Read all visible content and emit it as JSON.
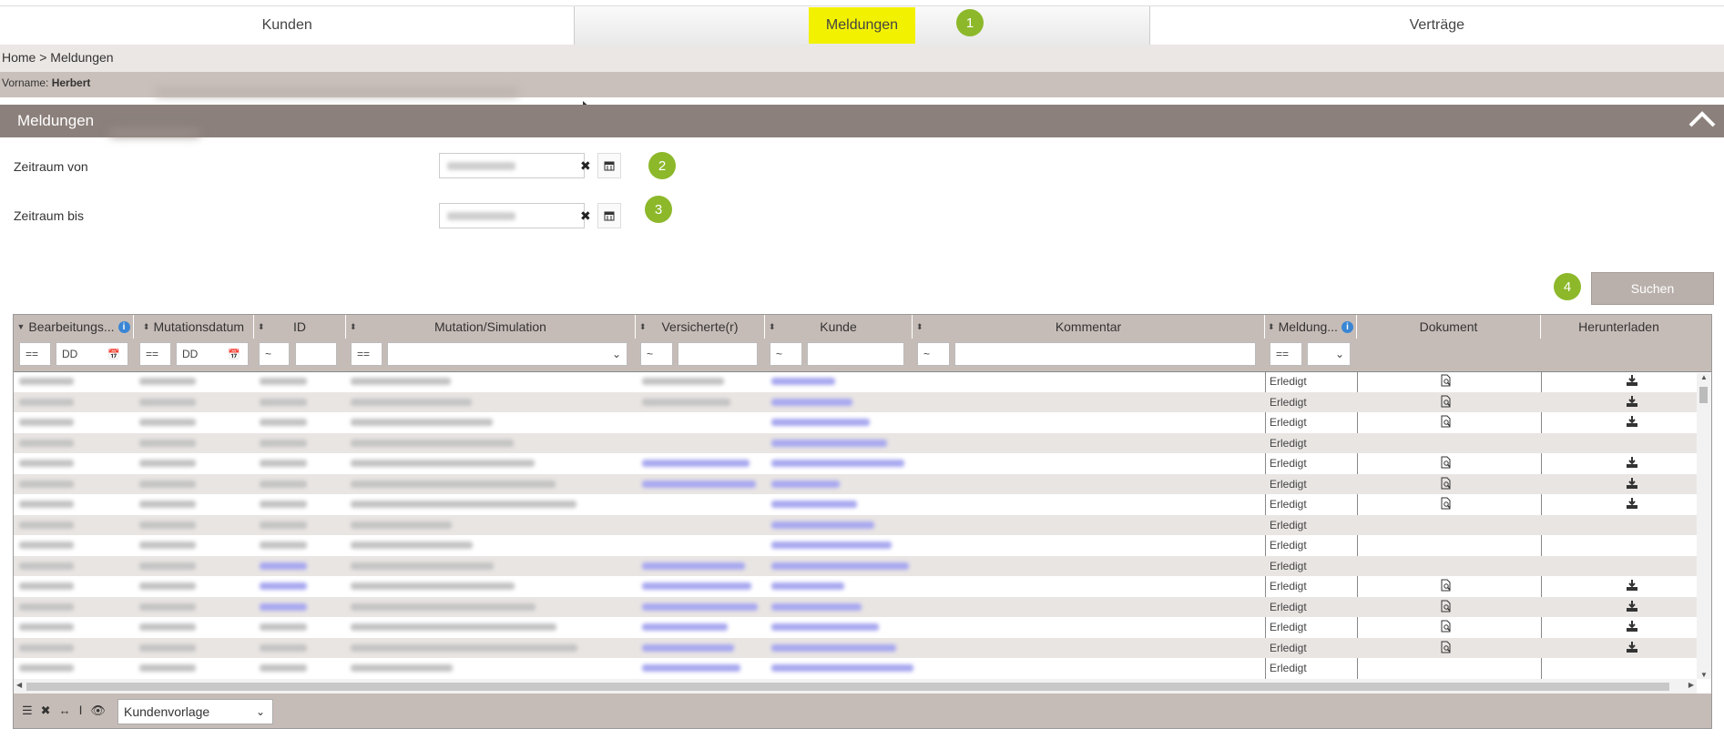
{
  "tabs": [
    {
      "label": "Kunden"
    },
    {
      "label": "Meldungen"
    },
    {
      "label": "Verträge"
    }
  ],
  "badges": [
    "1",
    "2",
    "3",
    "4"
  ],
  "breadcrumb": "Home > Meldungen",
  "user": {
    "label": "Vorname:",
    "name": "Herbert"
  },
  "panel": {
    "title": "Meldungen"
  },
  "filters": {
    "from_label": "Zeitraum von",
    "to_label": "Zeitraum bis"
  },
  "search_button": "Suchen",
  "columns": [
    "Bearbeitungs...",
    "Mutationsdatum",
    "ID",
    "Mutation/Simulation",
    "Versicherte(r)",
    "Kunde",
    "Kommentar",
    "Meldung...",
    "Dokument",
    "Herunterladen"
  ],
  "filter_ops": {
    "eq": "==",
    "tilde": "~",
    "date_placeholder": "DD"
  },
  "status_value": "Erledigt",
  "rows": [
    {
      "status": "Erledigt",
      "doc": true,
      "dl": true
    },
    {
      "status": "Erledigt",
      "doc": true,
      "dl": true
    },
    {
      "status": "Erledigt",
      "doc": true,
      "dl": true
    },
    {
      "status": "Erledigt",
      "doc": false,
      "dl": false
    },
    {
      "status": "Erledigt",
      "doc": true,
      "dl": true
    },
    {
      "status": "Erledigt",
      "doc": true,
      "dl": true
    },
    {
      "status": "Erledigt",
      "doc": true,
      "dl": true
    },
    {
      "status": "Erledigt",
      "doc": false,
      "dl": false
    },
    {
      "status": "Erledigt",
      "doc": false,
      "dl": false
    },
    {
      "status": "Erledigt",
      "doc": false,
      "dl": false
    },
    {
      "status": "Erledigt",
      "doc": true,
      "dl": true
    },
    {
      "status": "Erledigt",
      "doc": true,
      "dl": true
    },
    {
      "status": "Erledigt",
      "doc": true,
      "dl": true
    },
    {
      "status": "Erledigt",
      "doc": true,
      "dl": true
    },
    {
      "status": "Erledigt",
      "doc": false,
      "dl": false
    }
  ],
  "footer": {
    "template": "Kundenvorlage"
  }
}
